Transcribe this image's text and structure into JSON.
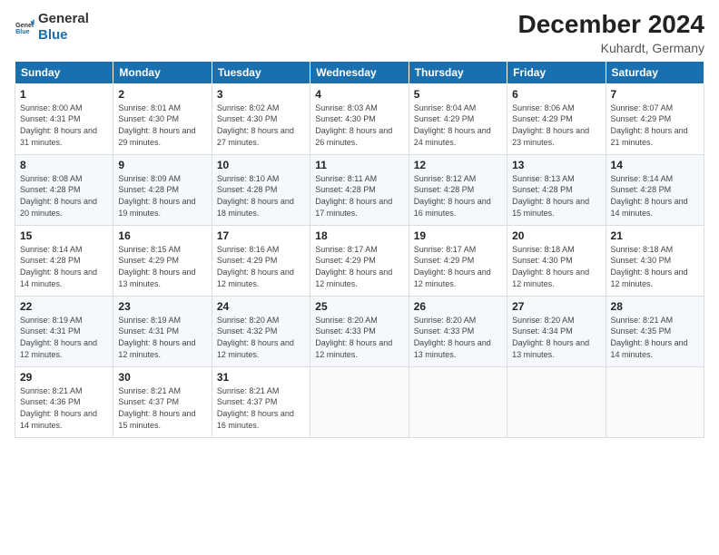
{
  "logo": {
    "general": "General",
    "blue": "Blue"
  },
  "header": {
    "title": "December 2024",
    "subtitle": "Kuhardt, Germany"
  },
  "days_of_week": [
    "Sunday",
    "Monday",
    "Tuesday",
    "Wednesday",
    "Thursday",
    "Friday",
    "Saturday"
  ],
  "weeks": [
    [
      {
        "day": "1",
        "sunrise": "8:00 AM",
        "sunset": "4:31 PM",
        "daylight": "8 hours and 31 minutes."
      },
      {
        "day": "2",
        "sunrise": "8:01 AM",
        "sunset": "4:30 PM",
        "daylight": "8 hours and 29 minutes."
      },
      {
        "day": "3",
        "sunrise": "8:02 AM",
        "sunset": "4:30 PM",
        "daylight": "8 hours and 27 minutes."
      },
      {
        "day": "4",
        "sunrise": "8:03 AM",
        "sunset": "4:30 PM",
        "daylight": "8 hours and 26 minutes."
      },
      {
        "day": "5",
        "sunrise": "8:04 AM",
        "sunset": "4:29 PM",
        "daylight": "8 hours and 24 minutes."
      },
      {
        "day": "6",
        "sunrise": "8:06 AM",
        "sunset": "4:29 PM",
        "daylight": "8 hours and 23 minutes."
      },
      {
        "day": "7",
        "sunrise": "8:07 AM",
        "sunset": "4:29 PM",
        "daylight": "8 hours and 21 minutes."
      }
    ],
    [
      {
        "day": "8",
        "sunrise": "8:08 AM",
        "sunset": "4:28 PM",
        "daylight": "8 hours and 20 minutes."
      },
      {
        "day": "9",
        "sunrise": "8:09 AM",
        "sunset": "4:28 PM",
        "daylight": "8 hours and 19 minutes."
      },
      {
        "day": "10",
        "sunrise": "8:10 AM",
        "sunset": "4:28 PM",
        "daylight": "8 hours and 18 minutes."
      },
      {
        "day": "11",
        "sunrise": "8:11 AM",
        "sunset": "4:28 PM",
        "daylight": "8 hours and 17 minutes."
      },
      {
        "day": "12",
        "sunrise": "8:12 AM",
        "sunset": "4:28 PM",
        "daylight": "8 hours and 16 minutes."
      },
      {
        "day": "13",
        "sunrise": "8:13 AM",
        "sunset": "4:28 PM",
        "daylight": "8 hours and 15 minutes."
      },
      {
        "day": "14",
        "sunrise": "8:14 AM",
        "sunset": "4:28 PM",
        "daylight": "8 hours and 14 minutes."
      }
    ],
    [
      {
        "day": "15",
        "sunrise": "8:14 AM",
        "sunset": "4:28 PM",
        "daylight": "8 hours and 14 minutes."
      },
      {
        "day": "16",
        "sunrise": "8:15 AM",
        "sunset": "4:29 PM",
        "daylight": "8 hours and 13 minutes."
      },
      {
        "day": "17",
        "sunrise": "8:16 AM",
        "sunset": "4:29 PM",
        "daylight": "8 hours and 12 minutes."
      },
      {
        "day": "18",
        "sunrise": "8:17 AM",
        "sunset": "4:29 PM",
        "daylight": "8 hours and 12 minutes."
      },
      {
        "day": "19",
        "sunrise": "8:17 AM",
        "sunset": "4:29 PM",
        "daylight": "8 hours and 12 minutes."
      },
      {
        "day": "20",
        "sunrise": "8:18 AM",
        "sunset": "4:30 PM",
        "daylight": "8 hours and 12 minutes."
      },
      {
        "day": "21",
        "sunrise": "8:18 AM",
        "sunset": "4:30 PM",
        "daylight": "8 hours and 12 minutes."
      }
    ],
    [
      {
        "day": "22",
        "sunrise": "8:19 AM",
        "sunset": "4:31 PM",
        "daylight": "8 hours and 12 minutes."
      },
      {
        "day": "23",
        "sunrise": "8:19 AM",
        "sunset": "4:31 PM",
        "daylight": "8 hours and 12 minutes."
      },
      {
        "day": "24",
        "sunrise": "8:20 AM",
        "sunset": "4:32 PM",
        "daylight": "8 hours and 12 minutes."
      },
      {
        "day": "25",
        "sunrise": "8:20 AM",
        "sunset": "4:33 PM",
        "daylight": "8 hours and 12 minutes."
      },
      {
        "day": "26",
        "sunrise": "8:20 AM",
        "sunset": "4:33 PM",
        "daylight": "8 hours and 13 minutes."
      },
      {
        "day": "27",
        "sunrise": "8:20 AM",
        "sunset": "4:34 PM",
        "daylight": "8 hours and 13 minutes."
      },
      {
        "day": "28",
        "sunrise": "8:21 AM",
        "sunset": "4:35 PM",
        "daylight": "8 hours and 14 minutes."
      }
    ],
    [
      {
        "day": "29",
        "sunrise": "8:21 AM",
        "sunset": "4:36 PM",
        "daylight": "8 hours and 14 minutes."
      },
      {
        "day": "30",
        "sunrise": "8:21 AM",
        "sunset": "4:37 PM",
        "daylight": "8 hours and 15 minutes."
      },
      {
        "day": "31",
        "sunrise": "8:21 AM",
        "sunset": "4:37 PM",
        "daylight": "8 hours and 16 minutes."
      },
      null,
      null,
      null,
      null
    ]
  ],
  "labels": {
    "sunrise": "Sunrise:",
    "sunset": "Sunset:",
    "daylight": "Daylight:"
  }
}
